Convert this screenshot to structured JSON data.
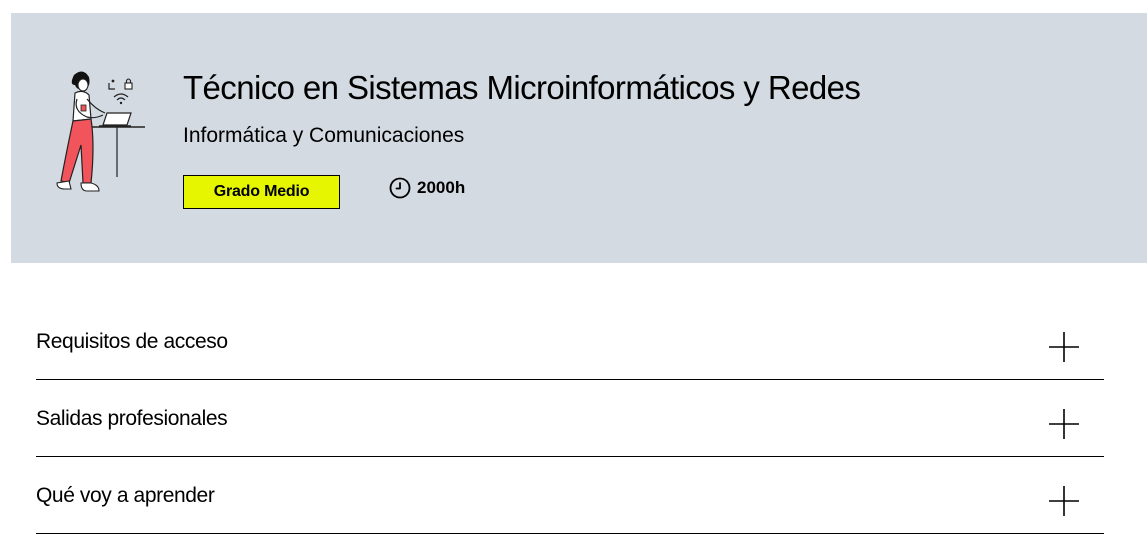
{
  "course": {
    "title": "Técnico en Sistemas Microinformáticos y Redes",
    "family": "Informática y Comunicaciones",
    "level": "Grado Medio",
    "duration": "2000h"
  },
  "accordion": {
    "items": [
      {
        "label": "Requisitos de acceso"
      },
      {
        "label": "Salidas profesionales"
      },
      {
        "label": "Qué voy a aprender"
      }
    ]
  },
  "icons": {
    "illustration": "person-at-laptop-illustration",
    "duration": "clock-icon",
    "expand": "plus-icon"
  },
  "colors": {
    "hero_background": "#d3dae1",
    "badge_background": "#e6f500",
    "illustration_accent": "#f2545b"
  }
}
